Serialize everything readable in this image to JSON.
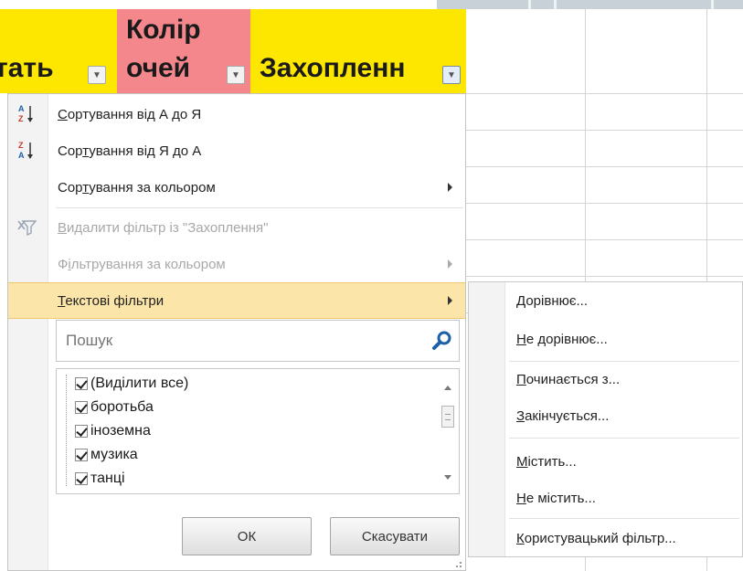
{
  "header": {
    "col1_partial": "тать",
    "col_eyes_line1": "Колір",
    "col_eyes_line2": "очей",
    "col_hobby": "Захопленн"
  },
  "menu": {
    "sort_az": {
      "accel": "С",
      "rest": "ортування від А до Я"
    },
    "sort_za": {
      "pre": "Сор",
      "accel": "т",
      "rest": "ування від Я до А"
    },
    "sort_color": {
      "pre": "Сор",
      "accel": "т",
      "rest": "ування за кольором"
    },
    "clear_filter": {
      "accel": "В",
      "rest": "идалити фільтр із \"Захоплення\""
    },
    "filter_color": {
      "pre": "Ф",
      "accel": "і",
      "rest": "льтрування за кольором"
    },
    "text_filters": {
      "accel": "Т",
      "rest": "екстові фільтри"
    }
  },
  "icons": {
    "sort_az": "sort-a-z-icon",
    "sort_za": "sort-z-a-icon",
    "clear_filter": "clear-filter-icon",
    "search": "magnifier-icon"
  },
  "search": {
    "placeholder": "Пошук"
  },
  "list_items": [
    {
      "label": "(Виділити все)",
      "checked": true
    },
    {
      "label": "боротьба",
      "checked": true
    },
    {
      "label": "іноземна",
      "checked": true
    },
    {
      "label": "музика",
      "checked": true
    },
    {
      "label": "танці",
      "checked": true
    }
  ],
  "buttons": {
    "ok": "ОК",
    "cancel": "Скасувати"
  },
  "submenu": {
    "equals": {
      "accel": "",
      "rest": "Дорівнює..."
    },
    "not_equals": {
      "accel": "Н",
      "rest": "е дорівнює..."
    },
    "begins_with": {
      "accel": "П",
      "rest": "очинається з..."
    },
    "ends_with": {
      "accel": "З",
      "rest": "акінчується..."
    },
    "contains": {
      "pre": "",
      "accel": "М",
      "rest": "істить..."
    },
    "not_contains": {
      "accel": "Н",
      "rest": "е містить..."
    },
    "custom": {
      "accel": "К",
      "rest": "ористувацький фільтр..."
    }
  },
  "colors": {
    "header_yellow": "#fde600",
    "header_pink": "#f4878c",
    "highlight": "#fbe5a8",
    "search_icon": "#1d5fa8"
  }
}
